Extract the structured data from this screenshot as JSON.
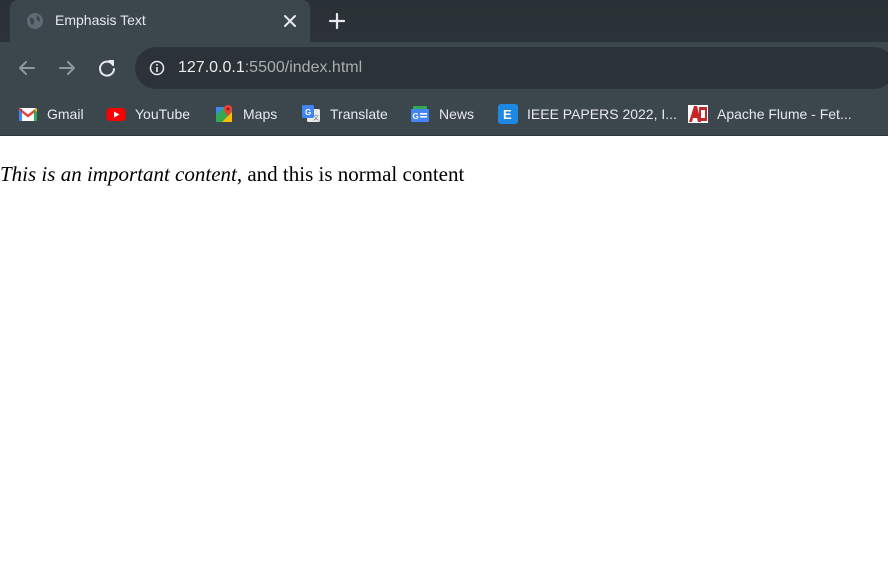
{
  "tab": {
    "title": "Emphasis Text",
    "favicon": "globe-icon"
  },
  "toolbar": {
    "url_host": "127.0.0.1",
    "url_rest": ":5500/index.html"
  },
  "bookmarks": [
    {
      "label": "Gmail",
      "icon": "gmail-icon"
    },
    {
      "label": "YouTube",
      "icon": "youtube-icon"
    },
    {
      "label": "Maps",
      "icon": "maps-icon"
    },
    {
      "label": "Translate",
      "icon": "translate-icon"
    },
    {
      "label": "News",
      "icon": "news-icon"
    },
    {
      "label": "IEEE PAPERS 2022, I...",
      "icon": "ieee-icon"
    },
    {
      "label": "Apache Flume - Fet...",
      "icon": "apache-flume-icon"
    }
  ],
  "content": {
    "emphasis": "This is an important content",
    "normal": ", and this is normal content"
  },
  "colors": {
    "tab_strip": "#2b3338",
    "toolbar": "#3c464d",
    "text_light": "#e8eaed",
    "url_dim": "#a9aeb2"
  }
}
